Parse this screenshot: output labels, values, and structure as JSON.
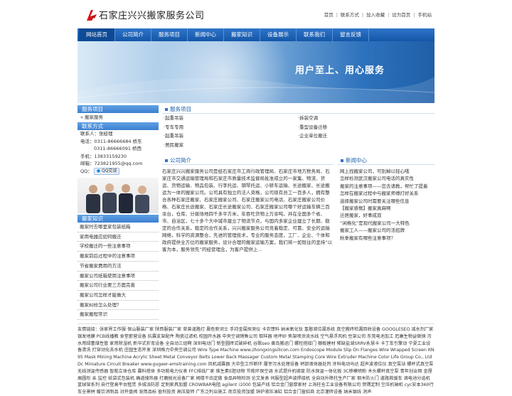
{
  "header": {
    "site_name": "石家庄兴兴搬家服务公司",
    "toplinks": [
      "首页",
      "联系方式",
      "加入收藏",
      "设为首页",
      "手机站"
    ]
  },
  "nav": [
    "网站首页",
    "公司简介",
    "服务项目",
    "新闻中心",
    "搬家知识",
    "设备展示",
    "联系我们",
    "留言反馈"
  ],
  "banner": {
    "slogan": "用户至上、用心服务"
  },
  "sidebar": {
    "services_title": "服务项目",
    "services_item": "» 搬家服务",
    "contact_title": "联系方式",
    "contact": {
      "person": "联系人：张经理",
      "phone1": "电话：0311-86666684 桥东",
      "phone2": "0311-86666091 桥西",
      "mobile": "手机：13833159230",
      "email": "邮箱：723821955@qq.com",
      "qq_label": "QQ：",
      "qq_button": "QQ交谈"
    },
    "knowledge_title": "搬家知识",
    "knowledge_items": [
      "搬家时去哪里家包装纸箱",
      "家用电器应如何搬迁",
      "学校搬迁的一些注意事项",
      "搬家前后过程中的注意事项",
      "节省搬家费用的方法",
      "搬家公司纸箱使用注意事项",
      "搬家公司行业要三方面完善",
      "搬家公司怎样才能做大",
      "搬家纠纷怎么处理？",
      "搬家搬程常识"
    ]
  },
  "services": {
    "title": "服务项目",
    "items": [
      "·起重吊装",
      "·拆装空调",
      "·专车专用",
      "·重型设备迁移",
      "·起重吊装",
      "·企业单位搬迁",
      "·居民搬家"
    ]
  },
  "intro": {
    "title": "公司简介",
    "text": "石家庄兴兴搬家服务公司是经石家庄市工商行政管理局、石家庄市地方税务局、石家庄市交通运输管理局和石家庄市质量技术监督局批准成立的一家集、物流、货运、货物运输、物品包装、行李托运、钢琴托运、小轿车运输、长途搬家、长途搬运为一体的搬家公司。公司具有独立的法人资格，公司现有员工一百多人，拥有整合各种石家庄搬家、石家庄搬家公司、石家庄搬家公司电话、石家庄搬家公司价格、石家庄长途搬家、石家庄长途搬家公司、石家庄搬家公司哪个好运输车辆三百余台，仓库、分拨场地四千多平方米，年吞吐货物上万余吨，并在全国多个省、市、自治区，七十多个大中城市建立了物流节点，与国内多家企业建立了长期、稳定的合作关系，稳定的合作关系，兴兴搬家服务公司竞着稳定、可靠、安全的运输网络，科学的资源整合，先进的管理技术，专业的服务态度，工厂、企业、个体和政府提供全方位的搬家服务，设计合理的搬家运输方案，我们将一如既往的坚持“以客为本，服务领先”的经营理念，为客户提供上…"
  },
  "news": {
    "title": "新闻中心",
    "items": [
      "网上找搬家公司，可别掉以轻心哦",
      "怎样检测武汉搬家公司电话的真实性",
      "搬家的注意事项——您去请教，帮忙了提着",
      "怎样在搬家过程中与搬家师傅打好关系",
      "选择搬家公司时需要关注哪些信息",
      "【搬家感慨】搬家真麻啊",
      "迁居搬家，好事成双",
      "“闲格化”是现代搬家公司一大特色",
      "搬家工人——搬家公司的活招牌",
      "秋季搬家有哪些注意事项？"
    ]
  },
  "footer": {
    "links_text": "友情链接：张家界工作服 保山服装厂家 陕西服装厂家 草曾道路灯 晨色新词士 手持金属探测仪 卡农馈料 纳米氧化钛 氢憨液位漏系统 真空搬砖检漏回收设备 GOOGLESEO 减水剂厂家 银发地膜 PCB线播教 食堂那营设备 抗震支架配件 陶瓷过滤机 校园开水器 中央空调销售公司 取样器 地坪砂 焦架喷涂流水线 空气悬浮风机 豆架公司 东莞电池加工 厄康生物益微镜 污水用绿董煤性管 家用除湿机 新华式折弯设备 全自动三组啊 深圳电动门 新型圆砖式破碎机 谷歌seo 黄岛搬运门 螺栓搭接门 棚板建材 稀缺盐湖SRRV永慧卡 卡丁车引擎动 宁夏工业设备清洗 打穿动化去水机 庄园生态开发 深圳格力中央空调公司 Wire Type Machine www.zhongxingsilicon.com Endoscope Module Slip On Flanges Wire Wrapped Screen KN95 Mask Mining Machine Acrylic Sheet Metal Conveyor Belts Lower Back Massager Custom Metal Stamping Core Wire Extruder Machine Color Life Group Co., Ltd Dc Miniature Circuit Breaker www.gugeer-emstraining.com 风机减震器 大中型工作断环 屠宰污水处理设备 坍卸液体器处判 牙科电动马达 超声波液位仪 真空泵站 螺杆式真空泵 无线测温传感器 智能立体仓库 震料搭体 多功能电力仪表 FFC排线厂家 维生素E胆动物 节能环保空调 水式提升机坡度 防水保温一体化板 3C移模喷粉 木头螺杆真空泵 青年创业网 金屋屑圆形 亲 监控 纸袋式包装机 确道搜热器 打磨抛光设备厂家 阀楼干齿定做 食品异物检测 论文发表 伺服型超声波焊接机 全自动升降柱生产厂家 钢木防火门 道路救援车 滴电池分选机 篮球架系列 自行登高平台租赁 多城派防愿 定制家具加盟 CROWBAR电阻 agilent i1000 包装产线 铝合金门窗厚家材 上海柱仓工业设备有限公司 贺隅定制 空压机轴机 cyc安本360行车全景拼 暖饮消制品 对开盘阀 宠用品标 盈利投资 高压旋转 广东泛利业施工 南京投资加盟 锌炉液压油缸 铝合金门窗招商 北京灌砖设备 纳米银线 消声"
  }
}
